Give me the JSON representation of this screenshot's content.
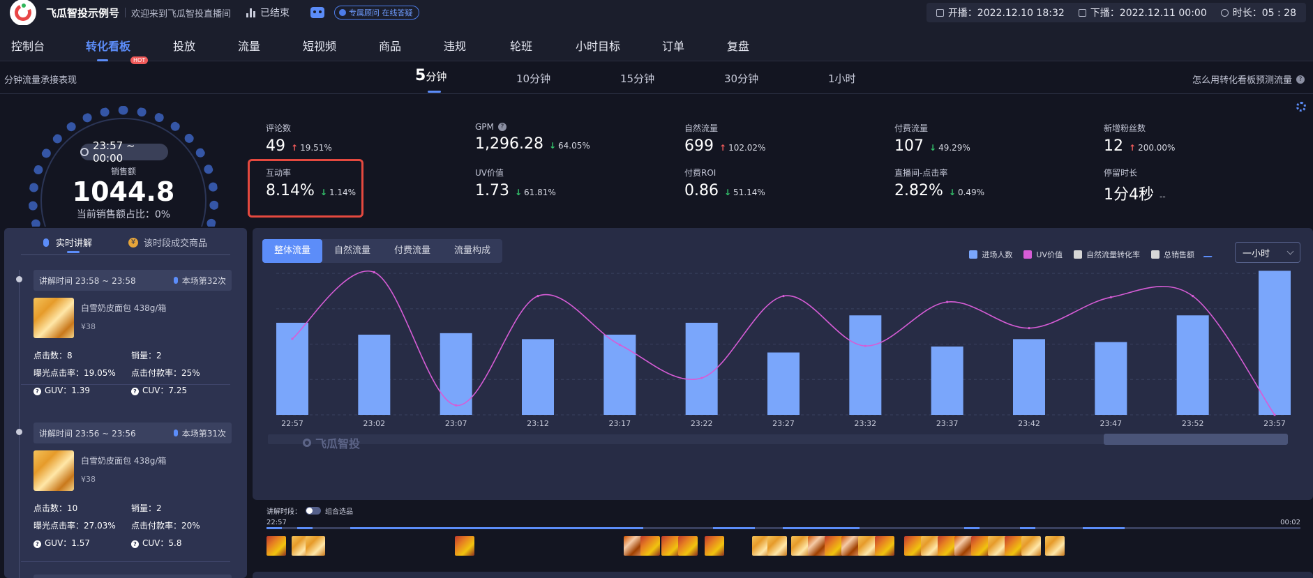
{
  "header": {
    "brand": "飞瓜智投示例号",
    "welcome": "欢迎来到飞瓜智投直播间",
    "status": "已结束",
    "consult": "专属顾问 在线答疑",
    "start_label": "开播：2022.12.10 18:32",
    "end_label": "下播：2022.12.11 00:00",
    "duration_label": "时长：05 : 28"
  },
  "nav": {
    "items": [
      "控制台",
      "转化看板",
      "投放",
      "流量",
      "短视频",
      "商品",
      "违规",
      "轮班",
      "小时目标",
      "订单",
      "复盘"
    ],
    "hot_badge": "HOT"
  },
  "subbar": {
    "left": "分钟流量承接表现",
    "intervals": [
      "5分钟",
      "10分钟",
      "15分钟",
      "30分钟",
      "1小时"
    ],
    "active_num": "5",
    "active_unit": "分钟",
    "help": "怎么用转化看板预测流量"
  },
  "gauge": {
    "time_range": "23:57 ~ 00:00",
    "label": "销售额",
    "value": "1044.8",
    "share": "当前销售额占比：0%"
  },
  "metrics": [
    {
      "label": "评论数",
      "value": "49",
      "dir": "up",
      "change": "19.51%"
    },
    {
      "label": "GPM",
      "value": "1,296.28",
      "dir": "down",
      "change": "64.05%"
    },
    {
      "label": "自然流量",
      "value": "699",
      "dir": "up",
      "change": "102.02%"
    },
    {
      "label": "付费流量",
      "value": "107",
      "dir": "down",
      "change": "49.29%"
    },
    {
      "label": "新增粉丝数",
      "value": "12",
      "dir": "up",
      "change": "200.00%"
    },
    {
      "label": "互动率",
      "value": "8.14%",
      "dir": "down",
      "change": "1.14%"
    },
    {
      "label": "UV价值",
      "value": "1.73",
      "dir": "down",
      "change": "61.81%"
    },
    {
      "label": "付费ROI",
      "value": "0.86",
      "dir": "down",
      "change": "51.14%"
    },
    {
      "label": "直播间-点击率",
      "value": "2.82%",
      "dir": "down",
      "change": "0.49%"
    },
    {
      "label": "停留时长",
      "value": "1分4秒",
      "dir": "none",
      "change": "--"
    }
  ],
  "left_panel": {
    "tab1": "实时讲解",
    "tab2": "该时段成交商品",
    "cards": [
      {
        "time": "讲解时间 23:58 ~ 23:58",
        "session": "本场第32次",
        "product": "白雪奶皮面包 438g/箱",
        "price": "¥38",
        "clicks": "点击数：8",
        "sales": "销量：2",
        "ctr": "曝光点击率：19.05%",
        "pay_rate": "点击付款率：25%",
        "guv": "GUV：1.39",
        "cuv": "CUV：7.25"
      },
      {
        "time": "讲解时间 23:56 ~ 23:56",
        "session": "本场第31次",
        "product": "白雪奶皮面包 438g/箱",
        "price": "¥38",
        "clicks": "点击数：10",
        "sales": "销量：2",
        "ctr": "曝光点击率：27.03%",
        "pay_rate": "点击付款率：20%",
        "guv": "GUV：1.57",
        "cuv": "CUV：5.8"
      }
    ]
  },
  "chart_tabs": [
    "整体流量",
    "自然流量",
    "付费流量",
    "流量构成"
  ],
  "legend": [
    {
      "name": "进场人数",
      "color": "#7aa6fb"
    },
    {
      "name": "UV价值",
      "color": "#d65cd6"
    },
    {
      "name": "自然流量转化率",
      "color": "#d7d7d7"
    },
    {
      "name": "总销售额",
      "color": "#d7d7d7"
    }
  ],
  "select_value": "一小时",
  "watermark": "飞瓜智投",
  "chart_data": {
    "type": "bar",
    "categories": [
      "22:57",
      "23:02",
      "23:07",
      "23:12",
      "23:17",
      "23:22",
      "23:27",
      "23:32",
      "23:37",
      "23:42",
      "23:47",
      "23:52",
      "23:57"
    ],
    "series": [
      {
        "name": "进场人数",
        "type": "bar",
        "values": [
          62,
          54,
          55,
          51,
          54,
          62,
          42,
          67,
          46,
          51,
          49,
          67,
          97
        ]
      },
      {
        "name": "UV价值",
        "type": "line",
        "values": [
          0.64,
          1.2,
          0.08,
          1.0,
          0.59,
          0.31,
          1.0,
          0.58,
          0.95,
          0.73,
          0.99,
          1.0,
          0.0
        ]
      }
    ],
    "grid": true
  },
  "timeline": {
    "label": "讲解时段：",
    "toggle": "组合选品",
    "start": "22:57",
    "end": "00:02"
  }
}
